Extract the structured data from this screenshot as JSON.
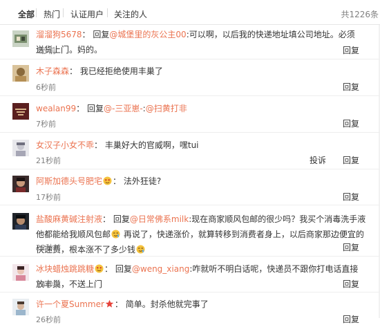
{
  "tabs": {
    "all": "全部",
    "hot": "热门",
    "verified": "认证用户",
    "following": "关注的人"
  },
  "total_count": "共1226条",
  "comments": [
    {
      "user": "溜溜狗5678",
      "sep": "：",
      "pre": "回复",
      "mention": "@城堡里的灰公主00",
      "text": ":可以啊，以后我的快递地址填公司地址。必须送货上门。妈的。",
      "time": "3秒前",
      "reply": "回复"
    },
    {
      "user": "木子森森",
      "sep": "：",
      "text": "我已经拒绝使用丰巢了",
      "time": "6秒前",
      "reply": "回复"
    },
    {
      "user": "wealan99",
      "sep": "：",
      "pre": "回复",
      "mention": "@-三亚崽-",
      "text_mid": ":",
      "mention2": "@扫黄打非",
      "time": "7秒前",
      "reply": "回复"
    },
    {
      "user": "女汉子小女不乖",
      "sep": "：",
      "text": "丰巢好大的官威啊，嘿tui",
      "time": "21秒前",
      "report": "投诉",
      "reply": "回复"
    },
    {
      "user": "阿斯加德头号肥宅",
      "sep": "：",
      "text": "法外狂徒?",
      "time": "17秒前",
      "reply": "回复"
    },
    {
      "user": "盐酸麻黄碱注射液",
      "sep": "：",
      "pre": "回复",
      "mention": "@日常佛系milk",
      "text": ":现在商家顺风包邮的很少吗？我买个消毒洗手液他都能给我顺风包邮",
      "text2": "再说了，快递涨价，就算转移到消费者身上，以后商家那边便宜的快递费，根本涨不了多少钱",
      "time": "22秒前",
      "reply": "回复"
    },
    {
      "user": "冰块蜡烛跳跳糖",
      "sep": "：",
      "pre": "回复",
      "mention": "@weng_xiang",
      "text": ":咋就听不明白话呢，快递员不跟你打电话直接放丰巢，不送上门",
      "time": "24秒前",
      "reply": "回复"
    },
    {
      "user": "许一个夏Summer",
      "sep": "：",
      "text": "简单。封杀他就完事了",
      "time": "26秒前",
      "reply": "回复"
    }
  ],
  "colors": {
    "link": "#eb7350",
    "text": "#333333",
    "muted": "#808080",
    "divider": "#eeeeee"
  },
  "icons": {
    "emoji": "smiley-face-icon",
    "star": "star-badge-icon"
  }
}
